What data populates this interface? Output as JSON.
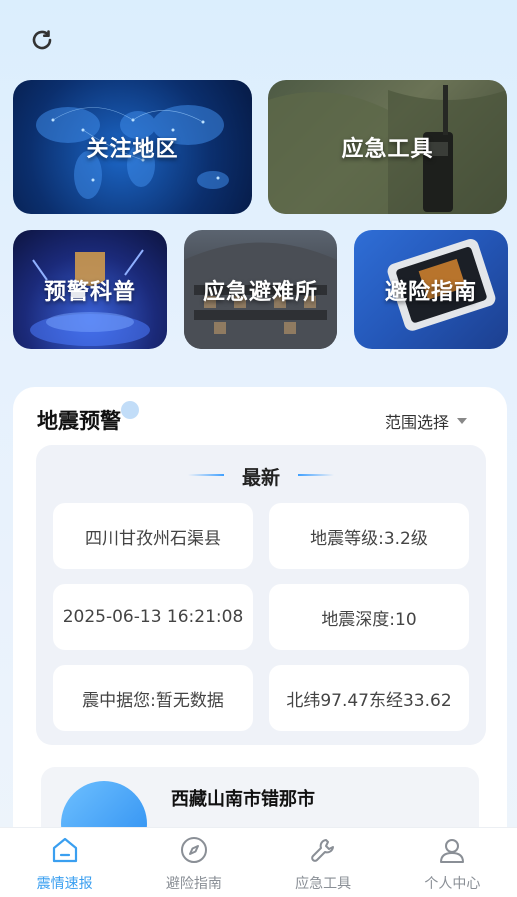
{
  "header": {
    "refresh_icon": "refresh-icon"
  },
  "cards": {
    "region": "关注地区",
    "tools": "应急工具",
    "science": "预警科普",
    "shelter": "应急避难所",
    "guide": "避险指南"
  },
  "warning": {
    "title": "地震预警",
    "range_select": "范围选择",
    "latest_label": "最新",
    "location": "四川甘孜州石渠县",
    "magnitude": "地震等级:3.2级",
    "time": "2025-06-13 16:21:08",
    "depth": "地震深度:10",
    "distance": "震中据您:暂无数据",
    "coords": "北纬97.47东经33.62"
  },
  "next_item": {
    "place": "西藏山南市错那市"
  },
  "tabbar": {
    "items": [
      {
        "label": "震情速报",
        "icon": "home-icon",
        "active": true
      },
      {
        "label": "避险指南",
        "icon": "compass-icon",
        "active": false
      },
      {
        "label": "应急工具",
        "icon": "wrench-icon",
        "active": false
      },
      {
        "label": "个人中心",
        "icon": "user-icon",
        "active": false
      }
    ]
  },
  "colors": {
    "accent": "#3a9ff0",
    "panel_bg": "#eff2f8"
  }
}
